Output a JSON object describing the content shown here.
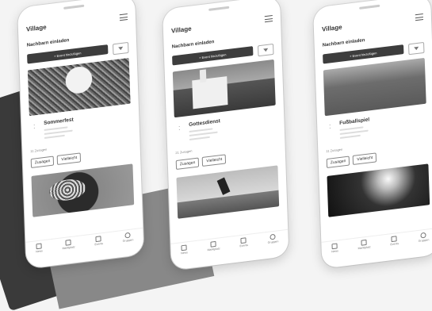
{
  "phones": [
    {
      "app_title": "Village",
      "invite_label": "Nachbarn einladen",
      "add_event_label": "+ Event hinzufügen",
      "event_title": "Sommerfest",
      "actions": {
        "accept": "Zusagen",
        "maybe": "Vielleicht"
      },
      "accept_count": "11 Zusagen"
    },
    {
      "app_title": "Village",
      "invite_label": "Nachbarn einladen",
      "add_event_label": "+ Event hinzufügen",
      "event_title": "Gottesdienst",
      "actions": {
        "accept": "Zusagen",
        "maybe": "Vielleicht"
      },
      "accept_count": "21 Zusagen"
    },
    {
      "app_title": "Village",
      "invite_label": "Nachbarn einladen",
      "add_event_label": "+ Event hinzufügen",
      "event_title": "Fußballspiel",
      "actions": {
        "accept": "Zusagen",
        "maybe": "Vielleicht"
      },
      "accept_count": "11 Zusagen"
    }
  ],
  "nav": {
    "news": "News",
    "marketplace": "Marktplatz",
    "events": "Events",
    "groups": "Gruppen"
  }
}
